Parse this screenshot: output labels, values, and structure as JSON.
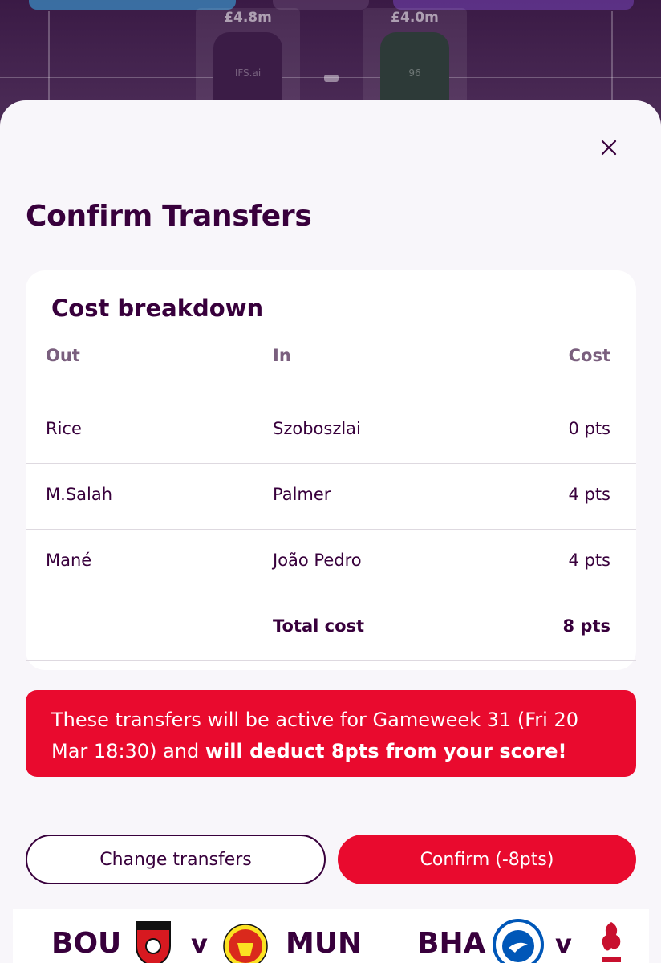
{
  "background": {
    "players": [
      {
        "price": "£4.8m",
        "shirt_text": "IFS.ai"
      },
      {
        "price": "£4.0m",
        "shirt_text": "96"
      }
    ]
  },
  "modal": {
    "title": "Confirm Transfers",
    "close_icon": "close-icon",
    "breakdown": {
      "title": "Cost breakdown",
      "headers": {
        "out": "Out",
        "in": "In",
        "cost": "Cost"
      },
      "rows": [
        {
          "out": "Rice",
          "in": "Szoboszlai",
          "cost": "0 pts"
        },
        {
          "out": "M.Salah",
          "in": "Palmer",
          "cost": "4 pts"
        },
        {
          "out": "Mané",
          "in": "João Pedro",
          "cost": "4 pts"
        }
      ],
      "total": {
        "label": "Total cost",
        "value": "8 pts"
      }
    },
    "alert": {
      "text": "These transfers will be active for Gameweek 31 (Fri 20 Mar 18:30) and ",
      "bold": "will deduct 8pts from your score!"
    },
    "buttons": {
      "change": "Change transfers",
      "confirm": "Confirm  (-8pts)"
    }
  },
  "fixtures": [
    {
      "home": "BOU",
      "away": "MUN",
      "separator": "v",
      "home_crest": "bournemouth-crest-icon",
      "away_crest": "man-utd-crest-icon"
    },
    {
      "home": "BHA",
      "away": "",
      "separator": "v",
      "home_crest": "brighton-crest-icon",
      "away_crest": "liverpool-crest-icon"
    }
  ],
  "colors": {
    "primary_purple": "#38003c",
    "accent_red": "#e90a2e",
    "muted_label": "#7a5f7e",
    "sheet_bg": "#f8f6fa"
  }
}
